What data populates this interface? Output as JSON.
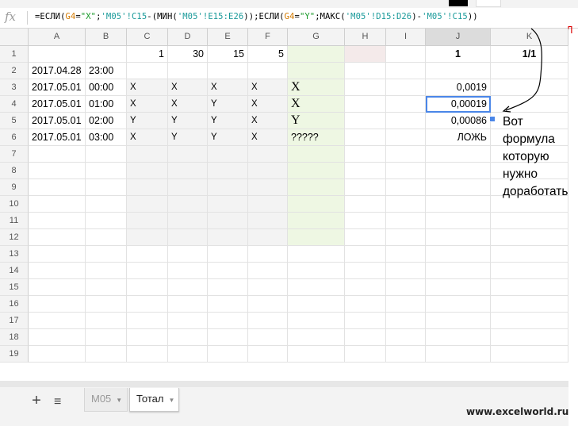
{
  "formula_bar": {
    "fx_label": "fx",
    "parts": [
      {
        "t": "=ЕСЛИ(",
        "c": "k"
      },
      {
        "t": "G4",
        "c": "o"
      },
      {
        "t": "=",
        "c": "k"
      },
      {
        "t": "\"X\"",
        "c": "s"
      },
      {
        "t": ";",
        "c": "k"
      },
      {
        "t": "'M05'!C15",
        "c": "r"
      },
      {
        "t": "-(МИН(",
        "c": "k"
      },
      {
        "t": "'M05'!E15:E26",
        "c": "r"
      },
      {
        "t": "));ЕСЛИ(",
        "c": "k"
      },
      {
        "t": "G4",
        "c": "o"
      },
      {
        "t": "=",
        "c": "k"
      },
      {
        "t": "\"Y\"",
        "c": "s"
      },
      {
        "t": ";МАКС(",
        "c": "k"
      },
      {
        "t": "'M05'!D15:D26",
        "c": "r"
      },
      {
        "t": ")-",
        "c": "k"
      },
      {
        "t": "'M05'!C15",
        "c": "r"
      },
      {
        "t": "))",
        "c": "k"
      }
    ],
    "overflow_mark": "Л"
  },
  "columns": [
    "A",
    "B",
    "C",
    "D",
    "E",
    "F",
    "G",
    "H",
    "I",
    "J",
    "K"
  ],
  "rows": [
    {
      "n": "1",
      "cells": [
        "",
        "",
        "1",
        "30",
        "15",
        "5",
        "",
        "",
        "",
        "1",
        "1/1"
      ]
    },
    {
      "n": "2",
      "cells": [
        "2017.04.28",
        "23:00",
        "",
        "",
        "",
        "",
        "",
        "",
        "",
        "",
        ""
      ]
    },
    {
      "n": "3",
      "cells": [
        "2017.05.01",
        "00:00",
        "X",
        "X",
        "X",
        "X",
        "X",
        "",
        "",
        "0,0019",
        ""
      ]
    },
    {
      "n": "4",
      "cells": [
        "2017.05.01",
        "01:00",
        "X",
        "X",
        "Y",
        "X",
        "X",
        "",
        "",
        "0,00019",
        ""
      ]
    },
    {
      "n": "5",
      "cells": [
        "2017.05.01",
        "02:00",
        "Y",
        "Y",
        "Y",
        "X",
        "Y",
        "",
        "",
        "0,00086",
        ""
      ]
    },
    {
      "n": "6",
      "cells": [
        "2017.05.01",
        "03:00",
        "X",
        "Y",
        "Y",
        "X",
        "?????",
        "",
        "",
        "ЛОЖЬ",
        ""
      ]
    },
    {
      "n": "7",
      "cells": [
        "",
        "",
        "",
        "",
        "",
        "",
        "",
        "",
        "",
        "",
        ""
      ]
    },
    {
      "n": "8",
      "cells": [
        "",
        "",
        "",
        "",
        "",
        "",
        "",
        "",
        "",
        "",
        ""
      ]
    },
    {
      "n": "9",
      "cells": [
        "",
        "",
        "",
        "",
        "",
        "",
        "",
        "",
        "",
        "",
        ""
      ]
    },
    {
      "n": "10",
      "cells": [
        "",
        "",
        "",
        "",
        "",
        "",
        "",
        "",
        "",
        "",
        ""
      ]
    },
    {
      "n": "11",
      "cells": [
        "",
        "",
        "",
        "",
        "",
        "",
        "",
        "",
        "",
        "",
        ""
      ]
    },
    {
      "n": "12",
      "cells": [
        "",
        "",
        "",
        "",
        "",
        "",
        "",
        "",
        "",
        "",
        ""
      ]
    },
    {
      "n": "13",
      "cells": [
        "",
        "",
        "",
        "",
        "",
        "",
        "",
        "",
        "",
        "",
        ""
      ]
    },
    {
      "n": "14",
      "cells": [
        "",
        "",
        "",
        "",
        "",
        "",
        "",
        "",
        "",
        "",
        ""
      ]
    },
    {
      "n": "15",
      "cells": [
        "",
        "",
        "",
        "",
        "",
        "",
        "",
        "",
        "",
        "",
        ""
      ]
    },
    {
      "n": "16",
      "cells": [
        "",
        "",
        "",
        "",
        "",
        "",
        "",
        "",
        "",
        "",
        ""
      ]
    },
    {
      "n": "17",
      "cells": [
        "",
        "",
        "",
        "",
        "",
        "",
        "",
        "",
        "",
        "",
        ""
      ]
    },
    {
      "n": "18",
      "cells": [
        "",
        "",
        "",
        "",
        "",
        "",
        "",
        "",
        "",
        "",
        ""
      ]
    },
    {
      "n": "19",
      "cells": [
        "",
        "",
        "",
        "",
        "",
        "",
        "",
        "",
        "",
        "",
        ""
      ]
    }
  ],
  "selected_cell": "J4",
  "annotation": {
    "lines": [
      "Вот",
      "формула",
      "которую",
      "нужно",
      "доработать"
    ]
  },
  "sheet_tabs": [
    {
      "label": "M05",
      "active": false
    },
    {
      "label": "Тотал",
      "active": true
    }
  ],
  "tab_bar": {
    "add_icon": "plus-icon",
    "list_icon": "sheet-list-icon"
  },
  "watermark": "www.excelworld.ru",
  "colors": {
    "selection": "#4a86e8",
    "header_bg": "#f3f3f3",
    "green_fill": "#eef7e3",
    "gray_fill": "#f3f3f3",
    "overflow_mark": "#dd0000"
  }
}
